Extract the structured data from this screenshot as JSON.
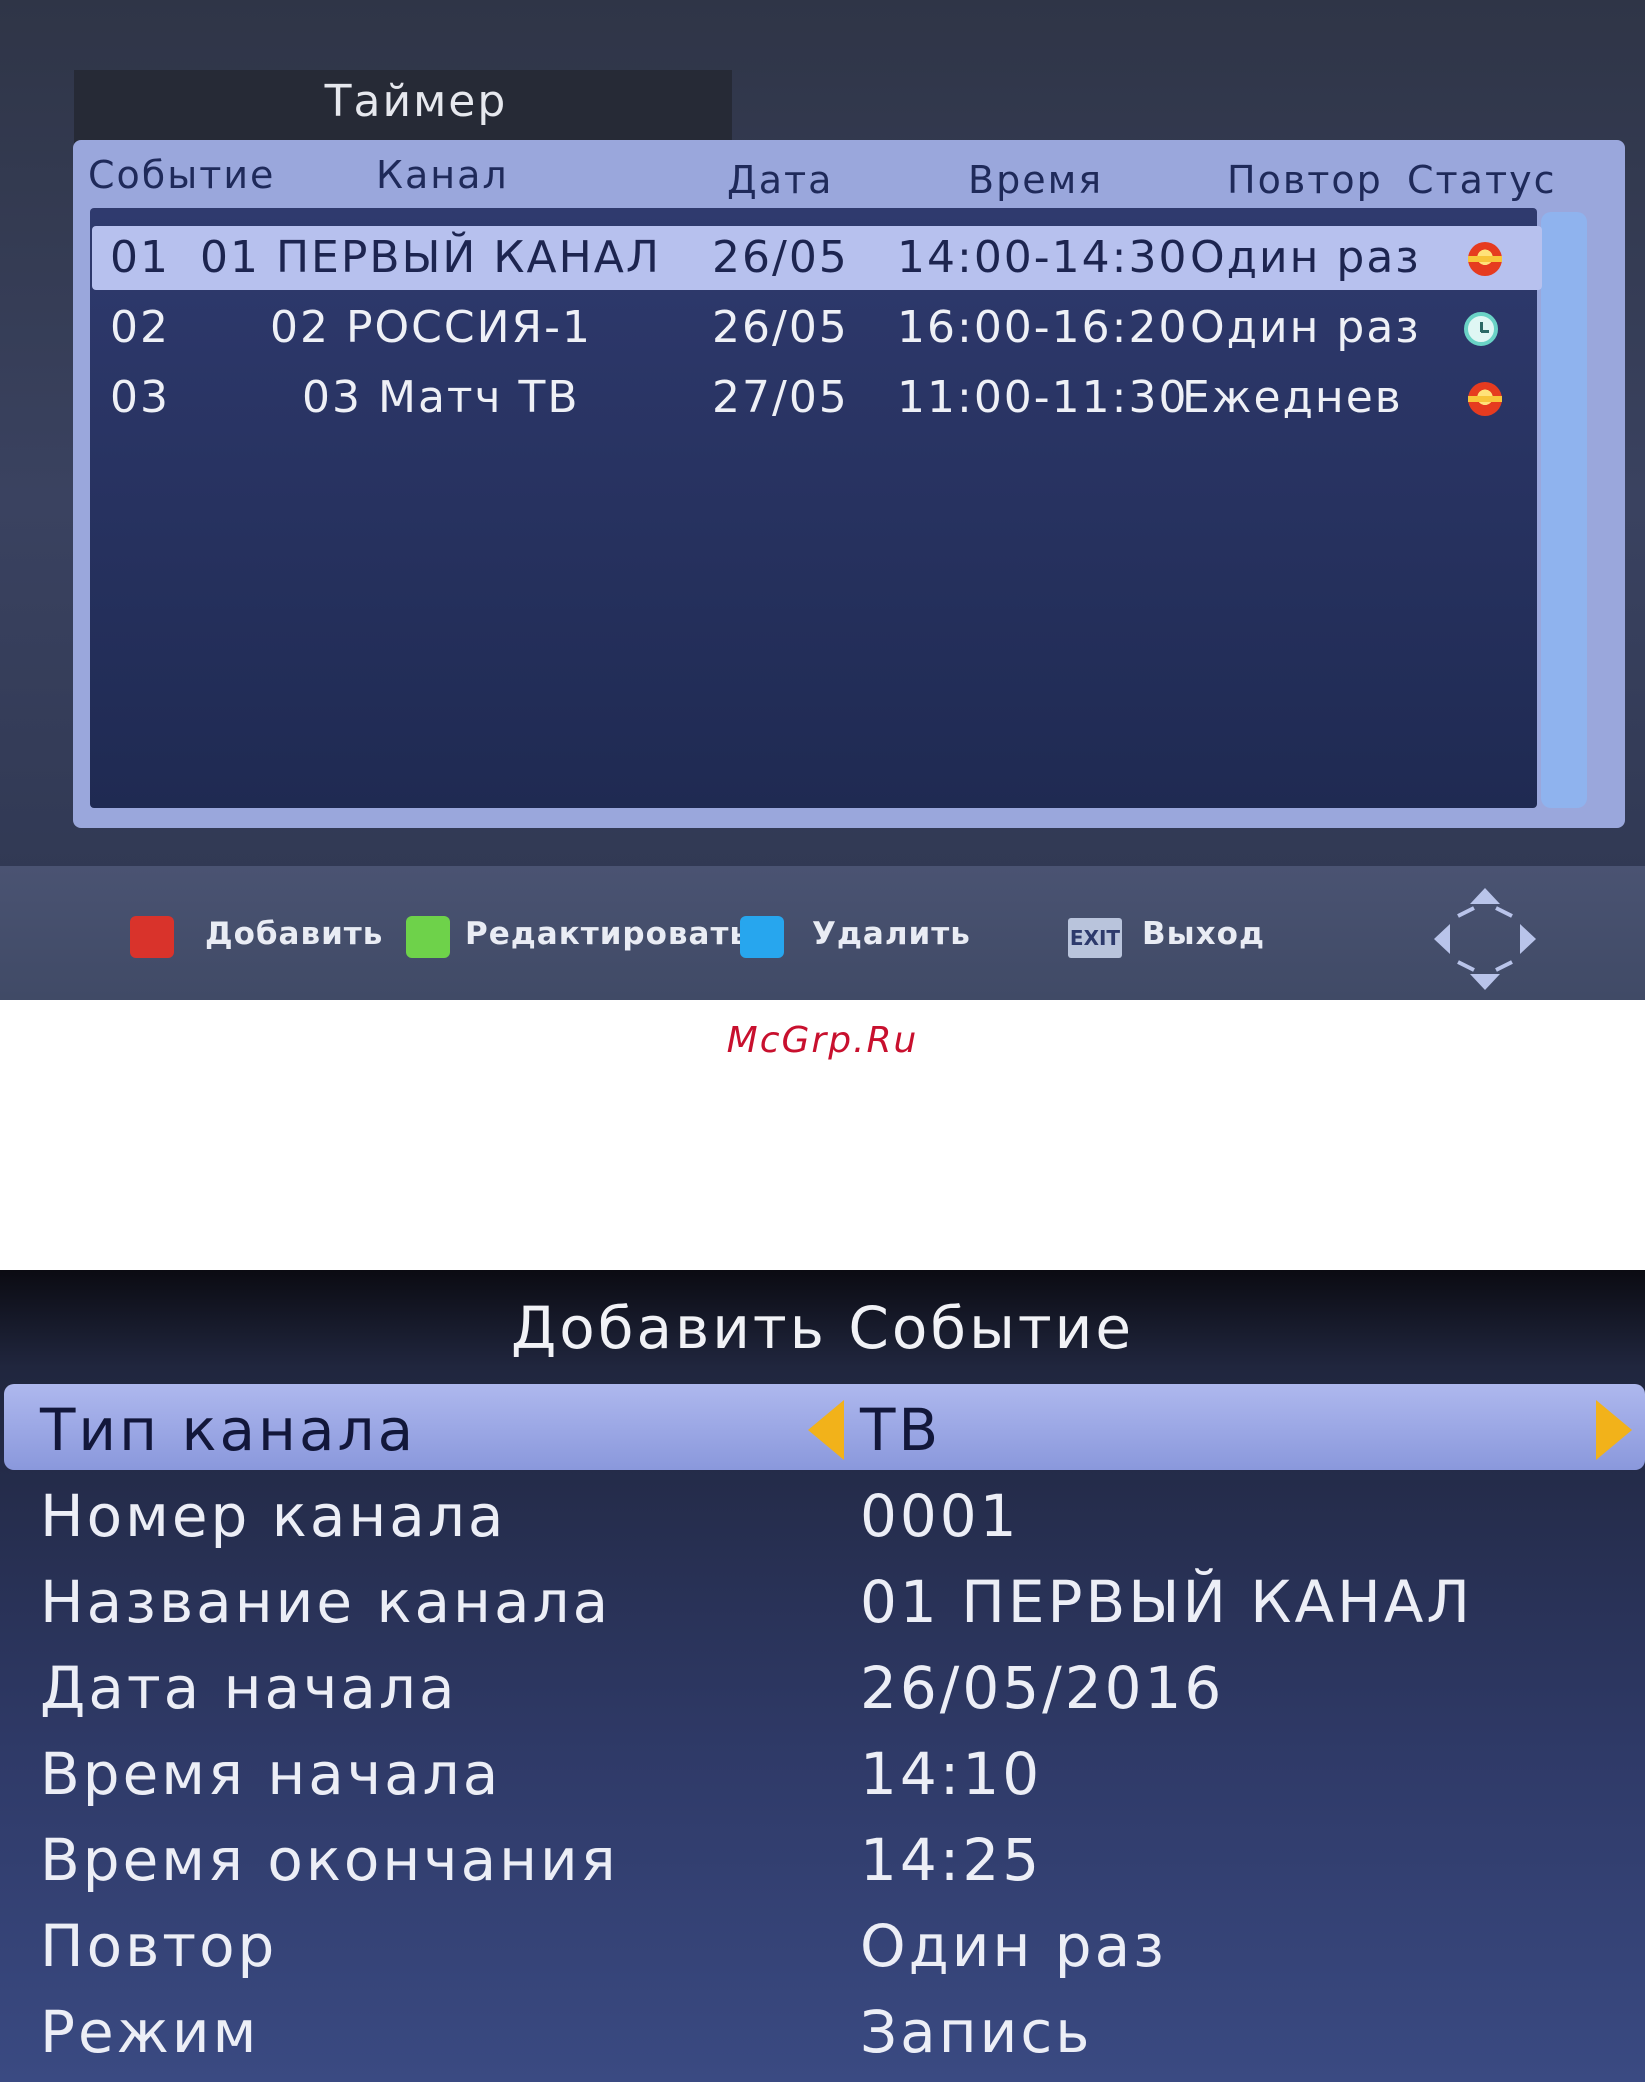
{
  "timer": {
    "title": "Таймер",
    "headers": {
      "event": "Событие",
      "channel": "Канал",
      "date": "Дата",
      "time": "Время",
      "repeat": "Повтор",
      "status": "Статус"
    },
    "rows": [
      {
        "event": "01",
        "channel": "01 ПЕРВЫЙ КАНАЛ",
        "date": "26/05",
        "time": "14:00-14:30",
        "repeat": "Один раз",
        "status": "record-icon"
      },
      {
        "event": "02",
        "channel": "02 РОССИЯ-1",
        "date": "26/05",
        "time": "16:00-16:20",
        "repeat": "Один раз",
        "status": "clock-icon"
      },
      {
        "event": "03",
        "channel": "03 Матч ТВ",
        "date": "27/05",
        "time": "11:00-11:30",
        "repeat": "Ежеднев",
        "status": "record-icon"
      }
    ],
    "hints": {
      "add": "Добавить",
      "edit": "Редактировать",
      "delete": "Удалить",
      "exit_key": "EXIT",
      "exit": "Выход"
    },
    "colors": {
      "add": "#d9332b",
      "edit": "#6ed24a",
      "delete": "#27a6ee"
    }
  },
  "watermark": "McGrp.Ru",
  "add_event": {
    "title": "Добавить Событие",
    "fields": [
      {
        "label": "Тип канала",
        "value": "ТВ"
      },
      {
        "label": "Номер канала",
        "value": "0001"
      },
      {
        "label": "Название канала",
        "value": "01 ПЕРВЫЙ КАНАЛ"
      },
      {
        "label": "Дата начала",
        "value": "26/05/2016"
      },
      {
        "label": "Время начала",
        "value": "14:10"
      },
      {
        "label": "Время окончания",
        "value": "14:25"
      },
      {
        "label": "Повтор",
        "value": "Один раз"
      },
      {
        "label": "Режим",
        "value": "Запись"
      }
    ]
  }
}
